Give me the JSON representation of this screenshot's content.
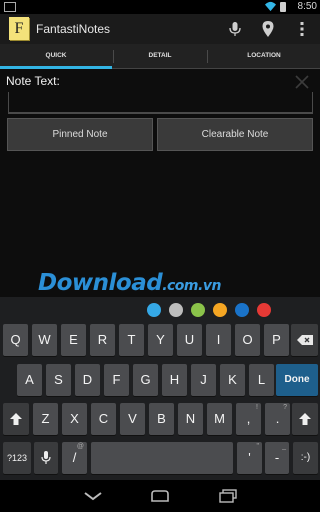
{
  "status": {
    "time": "8:50",
    "icons": [
      "image-icon",
      "wifi-icon",
      "battery-icon"
    ]
  },
  "actionbar": {
    "title": "FantastiNotes",
    "app_icon_letter": "F",
    "icons": [
      "microphone-icon",
      "location-pin-icon",
      "overflow-menu-icon"
    ]
  },
  "tabs": [
    {
      "label": "QUICK",
      "selected": true
    },
    {
      "label": "DETAIL",
      "selected": false
    },
    {
      "label": "LOCATION",
      "selected": false
    }
  ],
  "note": {
    "label": "Note Text:",
    "value": ""
  },
  "buttons": {
    "pinned": "Pinned Note",
    "clearable": "Clearable Note"
  },
  "watermark": {
    "main": "Download",
    "suffix": ".com.vn"
  },
  "keyboard": {
    "colors": [
      "#35a8e6",
      "#bdbdbd",
      "#8bc34a",
      "#f5a623",
      "#1a73c9",
      "#e53935"
    ],
    "row1": [
      "Q",
      "W",
      "E",
      "R",
      "T",
      "Y",
      "U",
      "I",
      "O",
      "P"
    ],
    "row2": [
      "A",
      "S",
      "D",
      "F",
      "G",
      "H",
      "J",
      "K",
      "L"
    ],
    "row3": [
      "Z",
      "X",
      "C",
      "V",
      "B",
      "N",
      "M",
      "!",
      "?"
    ],
    "row3_hints": [
      "",
      "",
      "",
      "",
      "",
      "",
      "",
      "!",
      "?"
    ],
    "row4": {
      "sym": "?123",
      "slash": "/",
      "slash_hint": "@",
      "apostrophe": "'",
      "apostrophe_hint": "\"",
      "dash": "-",
      "dash_hint": "_",
      "smiley": ":-)"
    },
    "done": "Done"
  },
  "accent": "#33b5e5"
}
